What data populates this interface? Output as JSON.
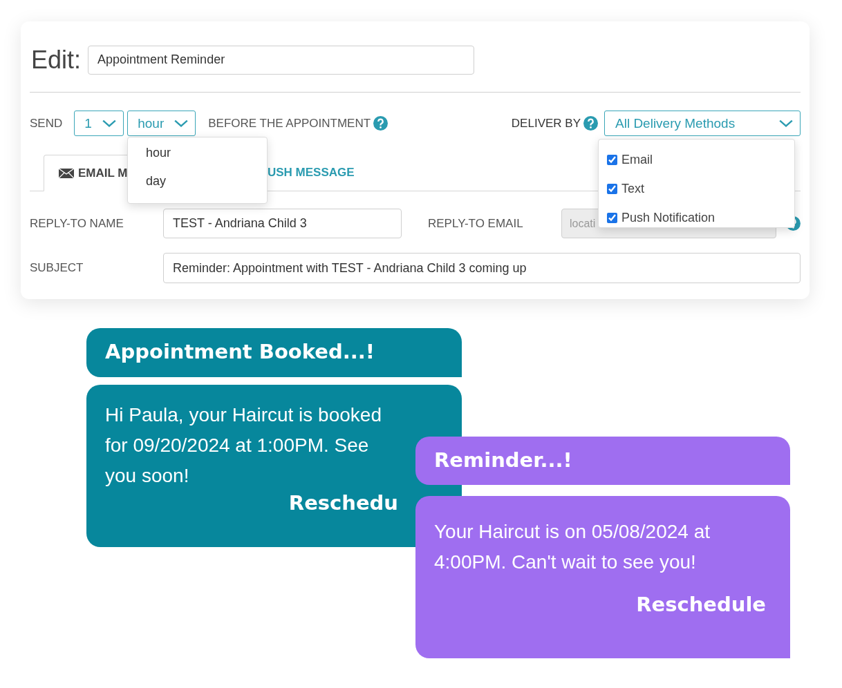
{
  "editor": {
    "heading": "Edit:",
    "name_value": "Appointment Reminder",
    "send": {
      "label": "SEND",
      "count": "1",
      "unit": "hour",
      "suffix": "BEFORE THE APPOINTMENT"
    },
    "unit_menu": [
      "hour",
      "day"
    ],
    "deliver_by": {
      "label": "DELIVER BY",
      "value": "All Delivery Methods",
      "options": [
        {
          "label": "Email",
          "checked": true
        },
        {
          "label": "Text",
          "checked": true
        },
        {
          "label": "Push Notification",
          "checked": true
        }
      ]
    },
    "tabs": [
      {
        "label": "EMAIL M",
        "selected": true
      },
      {
        "label": "USH MESSAGE",
        "selected": false
      }
    ],
    "fields": [
      {
        "label": "REPLY-TO NAME",
        "value": "TEST - Andriana Child 3",
        "disabled": false
      },
      {
        "label": "REPLY-TO EMAIL",
        "placeholder": "locati",
        "disabled": true
      },
      {
        "label": "SUBJECT",
        "value": "Reminder: Appointment with TEST - Andriana Child 3 coming up",
        "disabled": false
      }
    ]
  },
  "messages": [
    {
      "title": "Appointment Booked...!",
      "body": "Hi Paula, your Haircut is booked for 09/20/2024 at 1:00PM. See you soon!",
      "action": "Reschedu",
      "color": "#07879c"
    },
    {
      "title": "Reminder...!",
      "body": "Your Haircut is on 05/08/2024 at 4:00PM. Can't wait to see you!",
      "action": "Reschedule",
      "color": "#9f6ef0"
    }
  ]
}
